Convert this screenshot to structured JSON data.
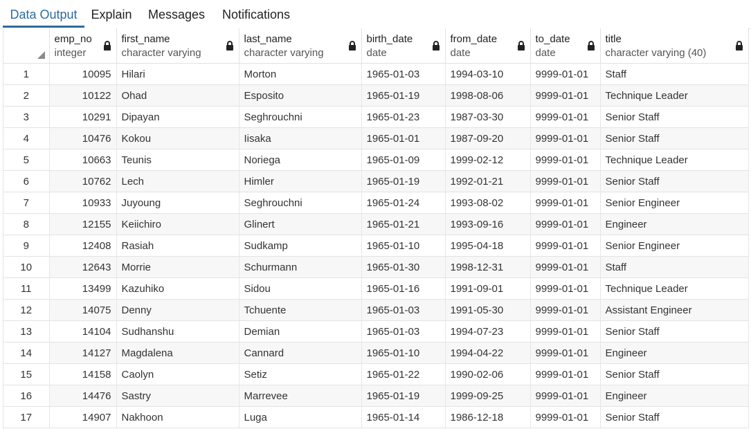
{
  "tabs": [
    {
      "label": "Data Output",
      "active": true
    },
    {
      "label": "Explain",
      "active": false
    },
    {
      "label": "Messages",
      "active": false
    },
    {
      "label": "Notifications",
      "active": false
    }
  ],
  "columns": [
    {
      "name": "emp_no",
      "type": "integer"
    },
    {
      "name": "first_name",
      "type": "character varying"
    },
    {
      "name": "last_name",
      "type": "character varying"
    },
    {
      "name": "birth_date",
      "type": "date"
    },
    {
      "name": "from_date",
      "type": "date"
    },
    {
      "name": "to_date",
      "type": "date"
    },
    {
      "name": "title",
      "type": "character varying (40)"
    }
  ],
  "rows": [
    [
      "1",
      "10095",
      "Hilari",
      "Morton",
      "1965-01-03",
      "1994-03-10",
      "9999-01-01",
      "Staff"
    ],
    [
      "2",
      "10122",
      "Ohad",
      "Esposito",
      "1965-01-19",
      "1998-08-06",
      "9999-01-01",
      "Technique Leader"
    ],
    [
      "3",
      "10291",
      "Dipayan",
      "Seghrouchni",
      "1965-01-23",
      "1987-03-30",
      "9999-01-01",
      "Senior Staff"
    ],
    [
      "4",
      "10476",
      "Kokou",
      "Iisaka",
      "1965-01-01",
      "1987-09-20",
      "9999-01-01",
      "Senior Staff"
    ],
    [
      "5",
      "10663",
      "Teunis",
      "Noriega",
      "1965-01-09",
      "1999-02-12",
      "9999-01-01",
      "Technique Leader"
    ],
    [
      "6",
      "10762",
      "Lech",
      "Himler",
      "1965-01-19",
      "1992-01-21",
      "9999-01-01",
      "Senior Staff"
    ],
    [
      "7",
      "10933",
      "Juyoung",
      "Seghrouchni",
      "1965-01-24",
      "1993-08-02",
      "9999-01-01",
      "Senior Engineer"
    ],
    [
      "8",
      "12155",
      "Keiichiro",
      "Glinert",
      "1965-01-21",
      "1993-09-16",
      "9999-01-01",
      "Engineer"
    ],
    [
      "9",
      "12408",
      "Rasiah",
      "Sudkamp",
      "1965-01-10",
      "1995-04-18",
      "9999-01-01",
      "Senior Engineer"
    ],
    [
      "10",
      "12643",
      "Morrie",
      "Schurmann",
      "1965-01-30",
      "1998-12-31",
      "9999-01-01",
      "Staff"
    ],
    [
      "11",
      "13499",
      "Kazuhiko",
      "Sidou",
      "1965-01-16",
      "1991-09-01",
      "9999-01-01",
      "Technique Leader"
    ],
    [
      "12",
      "14075",
      "Denny",
      "Tchuente",
      "1965-01-03",
      "1991-05-30",
      "9999-01-01",
      "Assistant Engineer"
    ],
    [
      "13",
      "14104",
      "Sudhanshu",
      "Demian",
      "1965-01-03",
      "1994-07-23",
      "9999-01-01",
      "Senior Staff"
    ],
    [
      "14",
      "14127",
      "Magdalena",
      "Cannard",
      "1965-01-10",
      "1994-04-22",
      "9999-01-01",
      "Engineer"
    ],
    [
      "15",
      "14158",
      "Caolyn",
      "Setiz",
      "1965-01-22",
      "1990-02-06",
      "9999-01-01",
      "Senior Staff"
    ],
    [
      "16",
      "14476",
      "Sastry",
      "Marrevee",
      "1965-01-19",
      "1999-09-25",
      "9999-01-01",
      "Engineer"
    ],
    [
      "17",
      "14907",
      "Nakhoon",
      "Luga",
      "1965-01-14",
      "1986-12-18",
      "9999-01-01",
      "Senior Staff"
    ]
  ],
  "colors": {
    "accent": "#2c6aa0",
    "stripe": "#f7f7f7",
    "border": "#dee2e6"
  },
  "icons": {
    "column_lock": "lock-icon",
    "corner": "corner-triangle-icon"
  }
}
